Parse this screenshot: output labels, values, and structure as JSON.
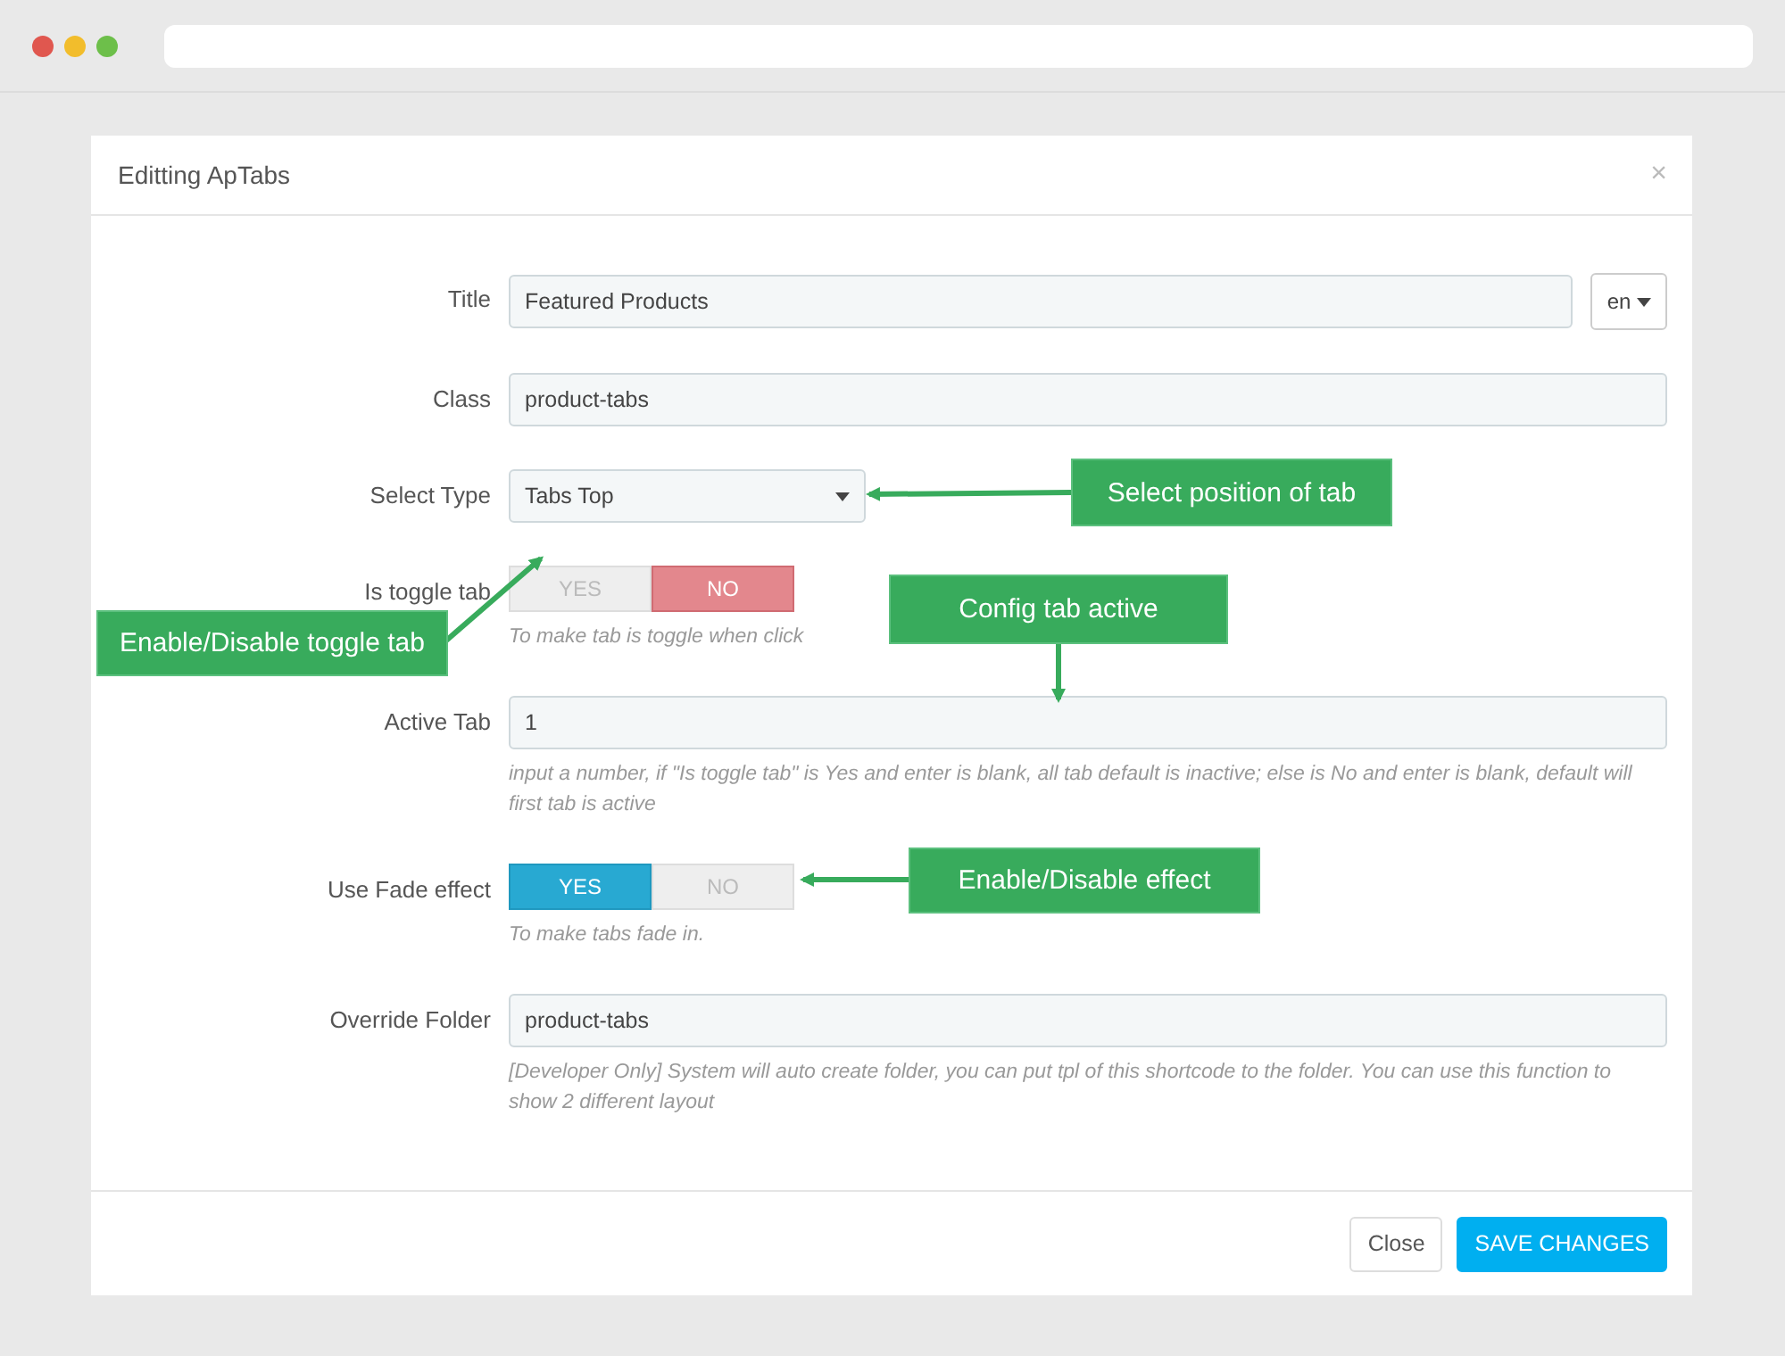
{
  "window": {
    "title": "Editting ApTabs",
    "close": "×"
  },
  "rows": [
    {
      "kind": "text",
      "label": "Title",
      "value": "Featured Products",
      "lang": "en"
    },
    {
      "kind": "text",
      "label": "Class",
      "value": "product-tabs"
    },
    {
      "kind": "select",
      "label": "Select Type",
      "value": "Tabs Top"
    },
    {
      "kind": "toggle",
      "label": "Is toggle tab",
      "options": [
        {
          "label": "YES",
          "selected": false
        },
        {
          "label": "NO",
          "selected": true
        }
      ],
      "help": "To make tab is toggle when click"
    },
    {
      "kind": "text",
      "label": "Active Tab",
      "value": "1",
      "help": "input a number, if \"Is toggle tab\" is Yes and enter is blank, all tab default is inactive; else is No and enter is blank, default will first tab is active"
    },
    {
      "kind": "toggle",
      "label": "Use Fade effect",
      "options": [
        {
          "label": "YES",
          "selected": true
        },
        {
          "label": "NO",
          "selected": false
        }
      ],
      "help": "To make tabs fade in."
    },
    {
      "kind": "text",
      "label": "Override Folder",
      "value": "product-tabs",
      "help": "[Developer Only] System will auto create folder, you can put tpl of this shortcode to the folder. You can use this function to show 2 different layout"
    }
  ],
  "annotations": [
    {
      "text": "Select position of tab"
    },
    {
      "text": "Enable/Disable toggle tab"
    },
    {
      "text": "Config tab active"
    },
    {
      "text": "Enable/Disable effect"
    }
  ],
  "footer": {
    "buttons": [
      {
        "label": "Close",
        "kind": "default"
      },
      {
        "label": "SAVE CHANGES",
        "kind": "primary"
      }
    ]
  }
}
